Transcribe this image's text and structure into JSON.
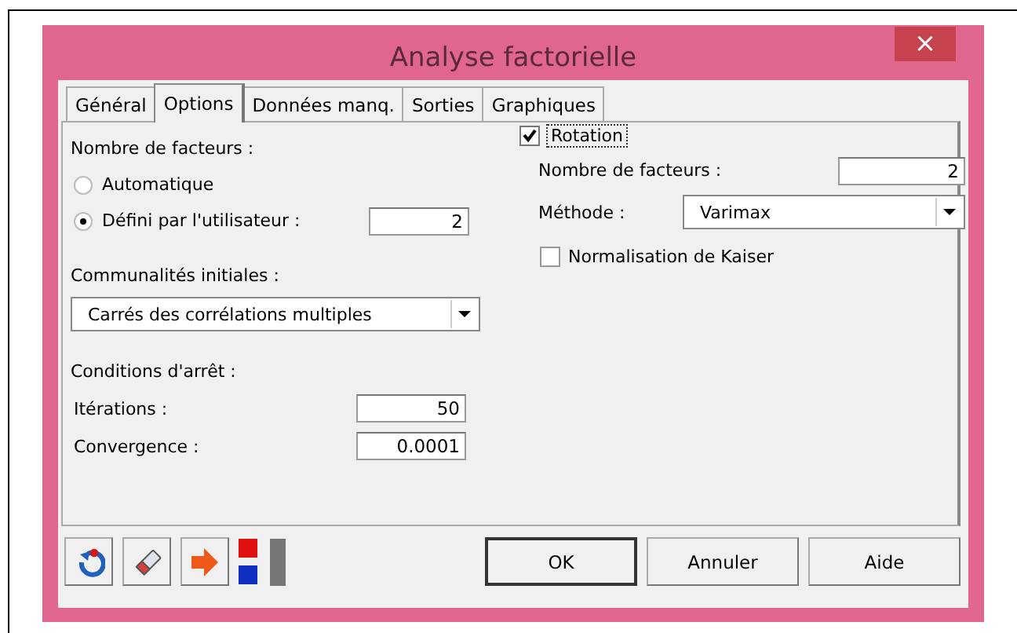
{
  "window": {
    "title": "Analyse factorielle",
    "close": "×"
  },
  "tabs": [
    {
      "label": "Général",
      "selected": false
    },
    {
      "label": "Options",
      "selected": true
    },
    {
      "label": "Données manq.",
      "selected": false
    },
    {
      "label": "Sorties",
      "selected": false
    },
    {
      "label": "Graphiques",
      "selected": false
    }
  ],
  "factors": {
    "label": "Nombre de facteurs :",
    "options": [
      {
        "label": "Automatique",
        "selected": false
      },
      {
        "label": "Défini par l'utilisateur :",
        "selected": true,
        "value": "2"
      }
    ]
  },
  "communalities": {
    "label": "Communalités initiales :",
    "value": "Carrés des corrélations multiples"
  },
  "stop": {
    "label": "Conditions d'arrêt :",
    "fields": [
      {
        "label": "Itérations :",
        "value": "50"
      },
      {
        "label": "Convergence :",
        "value": "0.0001"
      }
    ]
  },
  "rotation": {
    "label": "Rotation",
    "checked": true,
    "factors_label": "Nombre de facteurs :",
    "factors_value": "2",
    "method_label": "Méthode :",
    "method": "Varimax",
    "kaiser": {
      "label": "Normalisation de Kaiser",
      "checked": false
    }
  },
  "toolbar": [
    {
      "kind": "reset"
    },
    {
      "kind": "eraser"
    },
    {
      "kind": "arrow"
    },
    {
      "kind": "squares"
    },
    {
      "kind": "bar"
    }
  ],
  "buttons": [
    {
      "label": "OK",
      "default": true
    },
    {
      "label": "Annuler",
      "default": false
    },
    {
      "label": "Aide",
      "default": false
    }
  ]
}
